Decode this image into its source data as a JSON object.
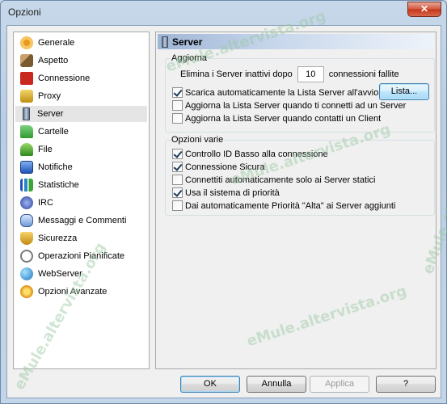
{
  "window": {
    "title": "Opzioni",
    "close_glyph": "✕"
  },
  "sidebar": {
    "items": [
      {
        "label": "Generale",
        "icon": "gear-icon",
        "color": "#e89a20"
      },
      {
        "label": "Aspetto",
        "icon": "brush-icon",
        "color": "#8a6f4a"
      },
      {
        "label": "Connessione",
        "icon": "plug-icon",
        "color": "#c8281f"
      },
      {
        "label": "Proxy",
        "icon": "proxy-icon",
        "color": "#e0b020"
      },
      {
        "label": "Server",
        "icon": "server-icon",
        "color": "#6d7f97"
      },
      {
        "label": "Cartelle",
        "icon": "folder-icon",
        "color": "#3aa63a"
      },
      {
        "label": "File",
        "icon": "file-icon",
        "color": "#3a9a2a"
      },
      {
        "label": "Notifiche",
        "icon": "notification-icon",
        "color": "#2a62c8"
      },
      {
        "label": "Statistiche",
        "icon": "statistics-icon",
        "color": "#2a62c8"
      },
      {
        "label": "IRC",
        "icon": "irc-icon",
        "color": "#2a3ea0"
      },
      {
        "label": "Messaggi e Commenti",
        "icon": "messages-icon",
        "color": "#2a62c8"
      },
      {
        "label": "Sicurezza",
        "icon": "security-icon",
        "color": "#d8a420"
      },
      {
        "label": "Operazioni Pianificate",
        "icon": "scheduler-icon",
        "color": "#7a7a7a"
      },
      {
        "label": "WebServer",
        "icon": "webserver-icon",
        "color": "#2a86c8"
      },
      {
        "label": "Opzioni Avanzate",
        "icon": "advanced-icon",
        "color": "#e8a020"
      }
    ],
    "selected": "Server"
  },
  "panel": {
    "title": "Server",
    "aggiorna": {
      "title": "Aggiorna",
      "remove_prefix": "Elimina i Server inattivi dopo",
      "remove_value": "10",
      "remove_suffix": "connessioni fallite",
      "options": [
        {
          "label": "Scarica automaticamente la Lista Server all'avvio",
          "checked": true
        },
        {
          "label": "Aggiorna la Lista Server quando ti connetti ad un Server",
          "checked": false
        },
        {
          "label": "Aggiorna la Lista Server quando contatti un Client",
          "checked": false
        }
      ],
      "lista_button": "Lista..."
    },
    "varie": {
      "title": "Opzioni varie",
      "options": [
        {
          "label": "Controllo ID Basso alla connessione",
          "checked": true
        },
        {
          "label": "Connessione Sicura",
          "checked": true
        },
        {
          "label": "Connettiti automaticamente solo ai Server statici",
          "checked": false
        },
        {
          "label": "Usa il sistema di priorità",
          "checked": true
        },
        {
          "label": "Dai automaticamente Priorità \"Alta\" ai Server aggiunti",
          "checked": false
        }
      ]
    }
  },
  "buttons": {
    "ok": "OK",
    "annulla": "Annulla",
    "applica": "Applica",
    "help": "?"
  },
  "watermark": "eMule.altervista.org"
}
